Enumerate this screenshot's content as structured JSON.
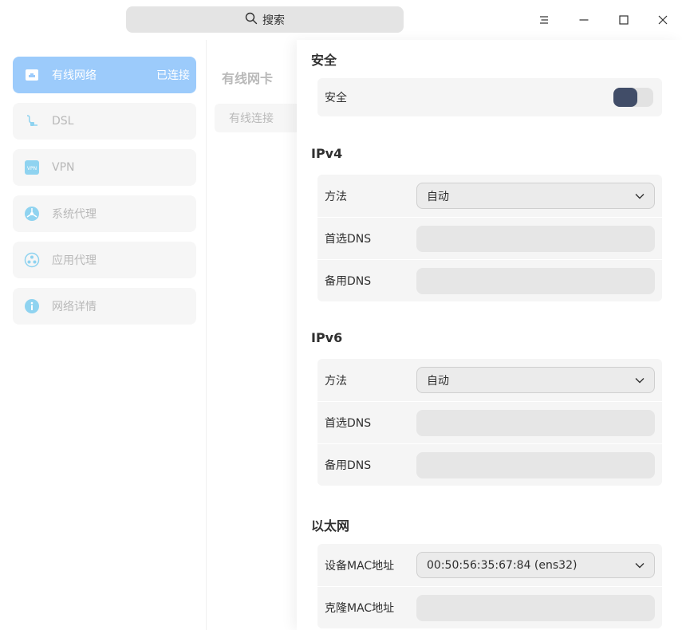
{
  "search": {
    "label": "搜索",
    "icon": "search-icon"
  },
  "window_controls": [
    "menu-icon",
    "minimize-icon",
    "maximize-icon",
    "close-icon"
  ],
  "sidebar": {
    "items": [
      {
        "label": "有线网络",
        "status": "已连接",
        "icon": "wired-network-icon",
        "active": true
      },
      {
        "label": "DSL",
        "icon": "dsl-icon"
      },
      {
        "label": "VPN",
        "icon": "vpn-icon"
      },
      {
        "label": "系统代理",
        "icon": "system-proxy-icon"
      },
      {
        "label": "应用代理",
        "icon": "app-proxy-icon"
      },
      {
        "label": "网络详情",
        "icon": "info-icon"
      }
    ]
  },
  "middle": {
    "title": "有线网卡",
    "items": [
      {
        "label": "有线连接"
      }
    ]
  },
  "security": {
    "title": "安全",
    "toggle_label": "安全",
    "toggle_on": false
  },
  "ipv4": {
    "title": "IPv4",
    "method_label": "方法",
    "method_value": "自动",
    "primary_dns_label": "首选DNS",
    "primary_dns_value": "",
    "secondary_dns_label": "备用DNS",
    "secondary_dns_value": ""
  },
  "ipv6": {
    "title": "IPv6",
    "method_label": "方法",
    "method_value": "自动",
    "primary_dns_label": "首选DNS",
    "primary_dns_value": "",
    "secondary_dns_label": "备用DNS",
    "secondary_dns_value": ""
  },
  "ethernet": {
    "title": "以太网",
    "device_mac_label": "设备MAC地址",
    "device_mac_value": "00:50:56:35:67:84 (ens32)",
    "clone_mac_label": "克隆MAC地址",
    "clone_mac_value": ""
  },
  "colors": {
    "accent": "#9ccbfb",
    "toggle_knob": "#414d68",
    "icon_blue": "#8fd3f0"
  }
}
